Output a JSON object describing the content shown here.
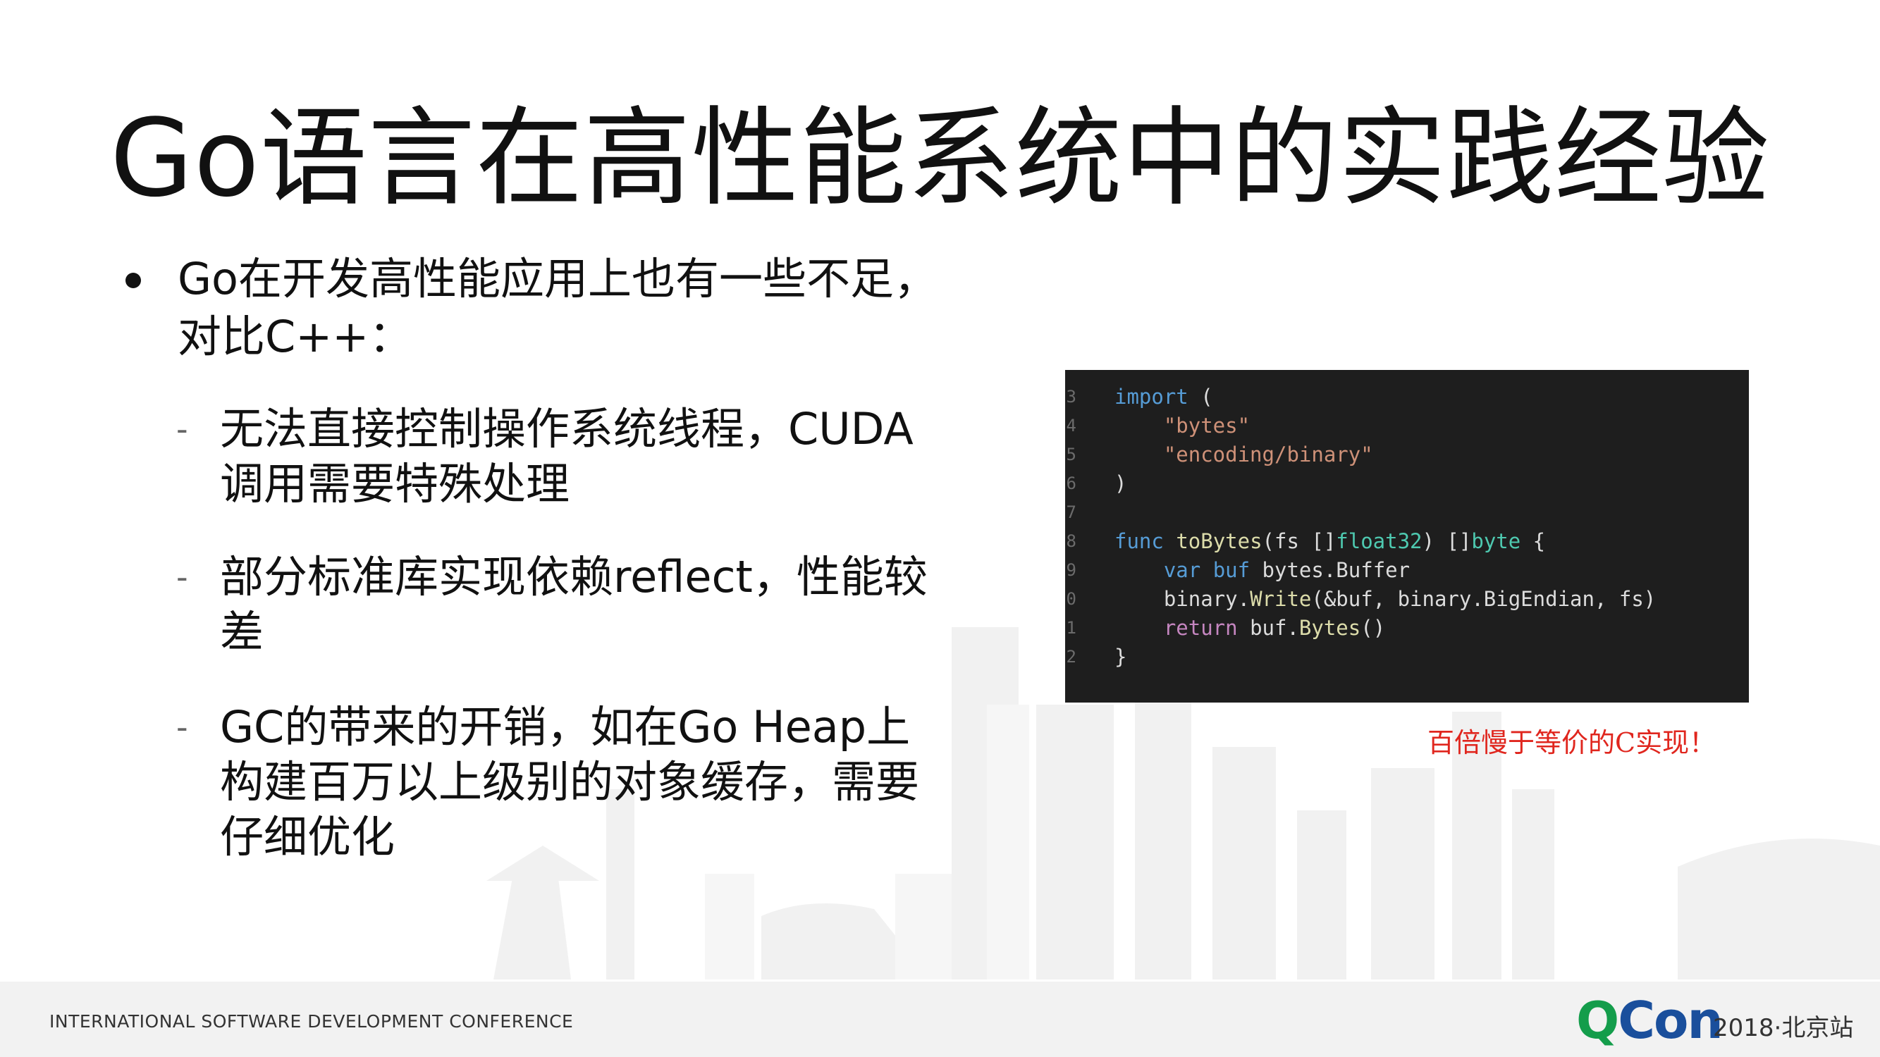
{
  "slide": {
    "title": "Go语言在高性能系统中的实践经验",
    "main_bullet": "Go在开发高性能应用上也有一些不足，对比C++：",
    "sub_bullets": [
      {
        "marker": "-",
        "text": "无法直接控制操作系统线程，CUDA调用需要特殊处理"
      },
      {
        "marker": "-",
        "text": "部分标准库实现依赖reflect，性能较差"
      },
      {
        "marker": "-",
        "text": "GC的带来的开销，如在Go Heap上构建百万以上级别的对象缓存，需要仔细优化"
      }
    ],
    "code_note": "百倍慢于等价的C实现！"
  },
  "code": {
    "line_numbers": [
      "3",
      "4",
      "5",
      "6",
      "7",
      "8",
      "9",
      "0",
      "1",
      "2"
    ],
    "lines": [
      [
        {
          "t": "import",
          "c": "kw"
        },
        {
          "t": " (",
          "c": ""
        }
      ],
      [
        {
          "t": "    ",
          "c": ""
        },
        {
          "t": "\"bytes\"",
          "c": "str"
        }
      ],
      [
        {
          "t": "    ",
          "c": ""
        },
        {
          "t": "\"encoding/binary\"",
          "c": "str"
        }
      ],
      [
        {
          "t": ")",
          "c": ""
        }
      ],
      [
        {
          "t": "",
          "c": ""
        }
      ],
      [
        {
          "t": "func",
          "c": "kw"
        },
        {
          "t": " ",
          "c": ""
        },
        {
          "t": "toBytes",
          "c": "fn"
        },
        {
          "t": "(fs []",
          "c": ""
        },
        {
          "t": "float32",
          "c": "typ"
        },
        {
          "t": ") []",
          "c": ""
        },
        {
          "t": "byte",
          "c": "typ"
        },
        {
          "t": " {",
          "c": ""
        }
      ],
      [
        {
          "t": "    ",
          "c": ""
        },
        {
          "t": "var",
          "c": "kw"
        },
        {
          "t": " ",
          "c": ""
        },
        {
          "t": "buf",
          "c": "kw"
        },
        {
          "t": " bytes.Buffer",
          "c": ""
        }
      ],
      [
        {
          "t": "    binary.",
          "c": ""
        },
        {
          "t": "Write",
          "c": "fn"
        },
        {
          "t": "(&buf, binary.BigEndian, fs)",
          "c": ""
        }
      ],
      [
        {
          "t": "    ",
          "c": ""
        },
        {
          "t": "return",
          "c": "kw2"
        },
        {
          "t": " buf.",
          "c": ""
        },
        {
          "t": "Bytes",
          "c": "fn"
        },
        {
          "t": "()",
          "c": ""
        }
      ],
      [
        {
          "t": "}",
          "c": ""
        }
      ]
    ]
  },
  "footer": {
    "conference": "INTERNATIONAL SOFTWARE DEVELOPMENT CONFERENCE",
    "logo_q": "Q",
    "logo_con": "Con",
    "event": "2018·北京站"
  },
  "colors": {
    "note_red": "#e0261e",
    "logo_green": "#149d4b",
    "logo_blue": "#1a4f9c",
    "code_bg": "#1e1e1e"
  }
}
